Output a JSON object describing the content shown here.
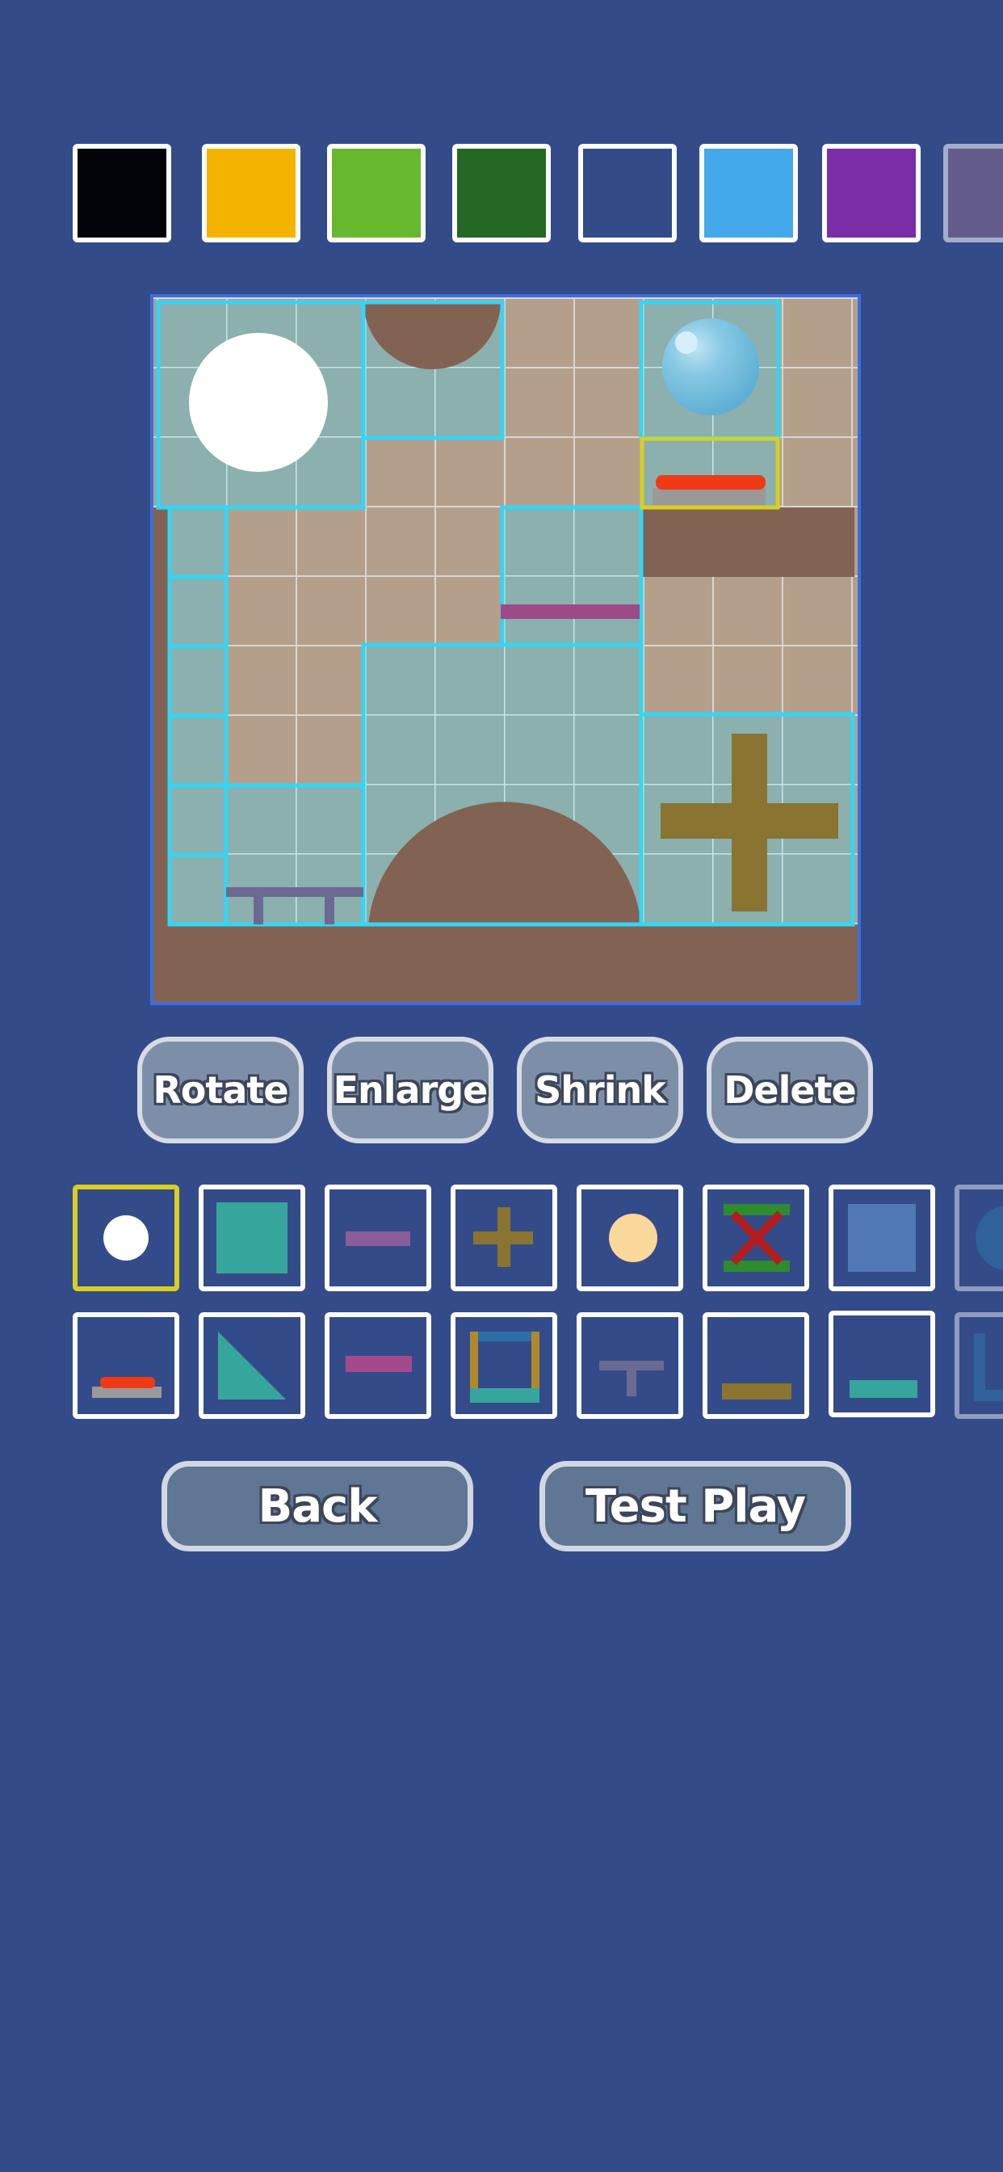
{
  "colors": {
    "background": "#344b8a",
    "board_border": "#3d6de0",
    "floor_brown": "#826253",
    "wall_tan": "#b4a08a",
    "glass_teal": "#8bb0ad",
    "cell_highlight": "#33d6f5",
    "selection_yellow": "#d8cf23"
  },
  "color_palette": [
    {
      "name": "black",
      "color": "#03040a"
    },
    {
      "name": "orange",
      "color": "#f5b301"
    },
    {
      "name": "lime-green",
      "color": "#67b82e"
    },
    {
      "name": "dark-green",
      "color": "#256824"
    },
    {
      "name": "navy",
      "color": "#344b8a"
    },
    {
      "name": "sky-blue",
      "color": "#44a9ea"
    },
    {
      "name": "purple",
      "color": "#7b2da8"
    },
    {
      "name": "mauve",
      "color": "#8a6a8a"
    }
  ],
  "actions": {
    "rotate": "Rotate",
    "enlarge": "Enlarge",
    "shrink": "Shrink",
    "delete": "Delete"
  },
  "pieces": {
    "row1": [
      "white-ball-icon",
      "teal-square-icon",
      "purple-bar-icon",
      "olive-cross-icon",
      "peach-ball-icon",
      "spring-x-icon",
      "blue-square-icon",
      "circle-icon"
    ],
    "row2": [
      "red-button-icon",
      "teal-triangle-icon",
      "magenta-bar-icon",
      "frame-box-icon",
      "t-table-icon",
      "olive-bar-icon",
      "teal-bar-icon",
      "l-shape-icon"
    ],
    "selected": "white-ball-icon"
  },
  "navigation": {
    "back": "Back",
    "test_play": "Test Play"
  }
}
